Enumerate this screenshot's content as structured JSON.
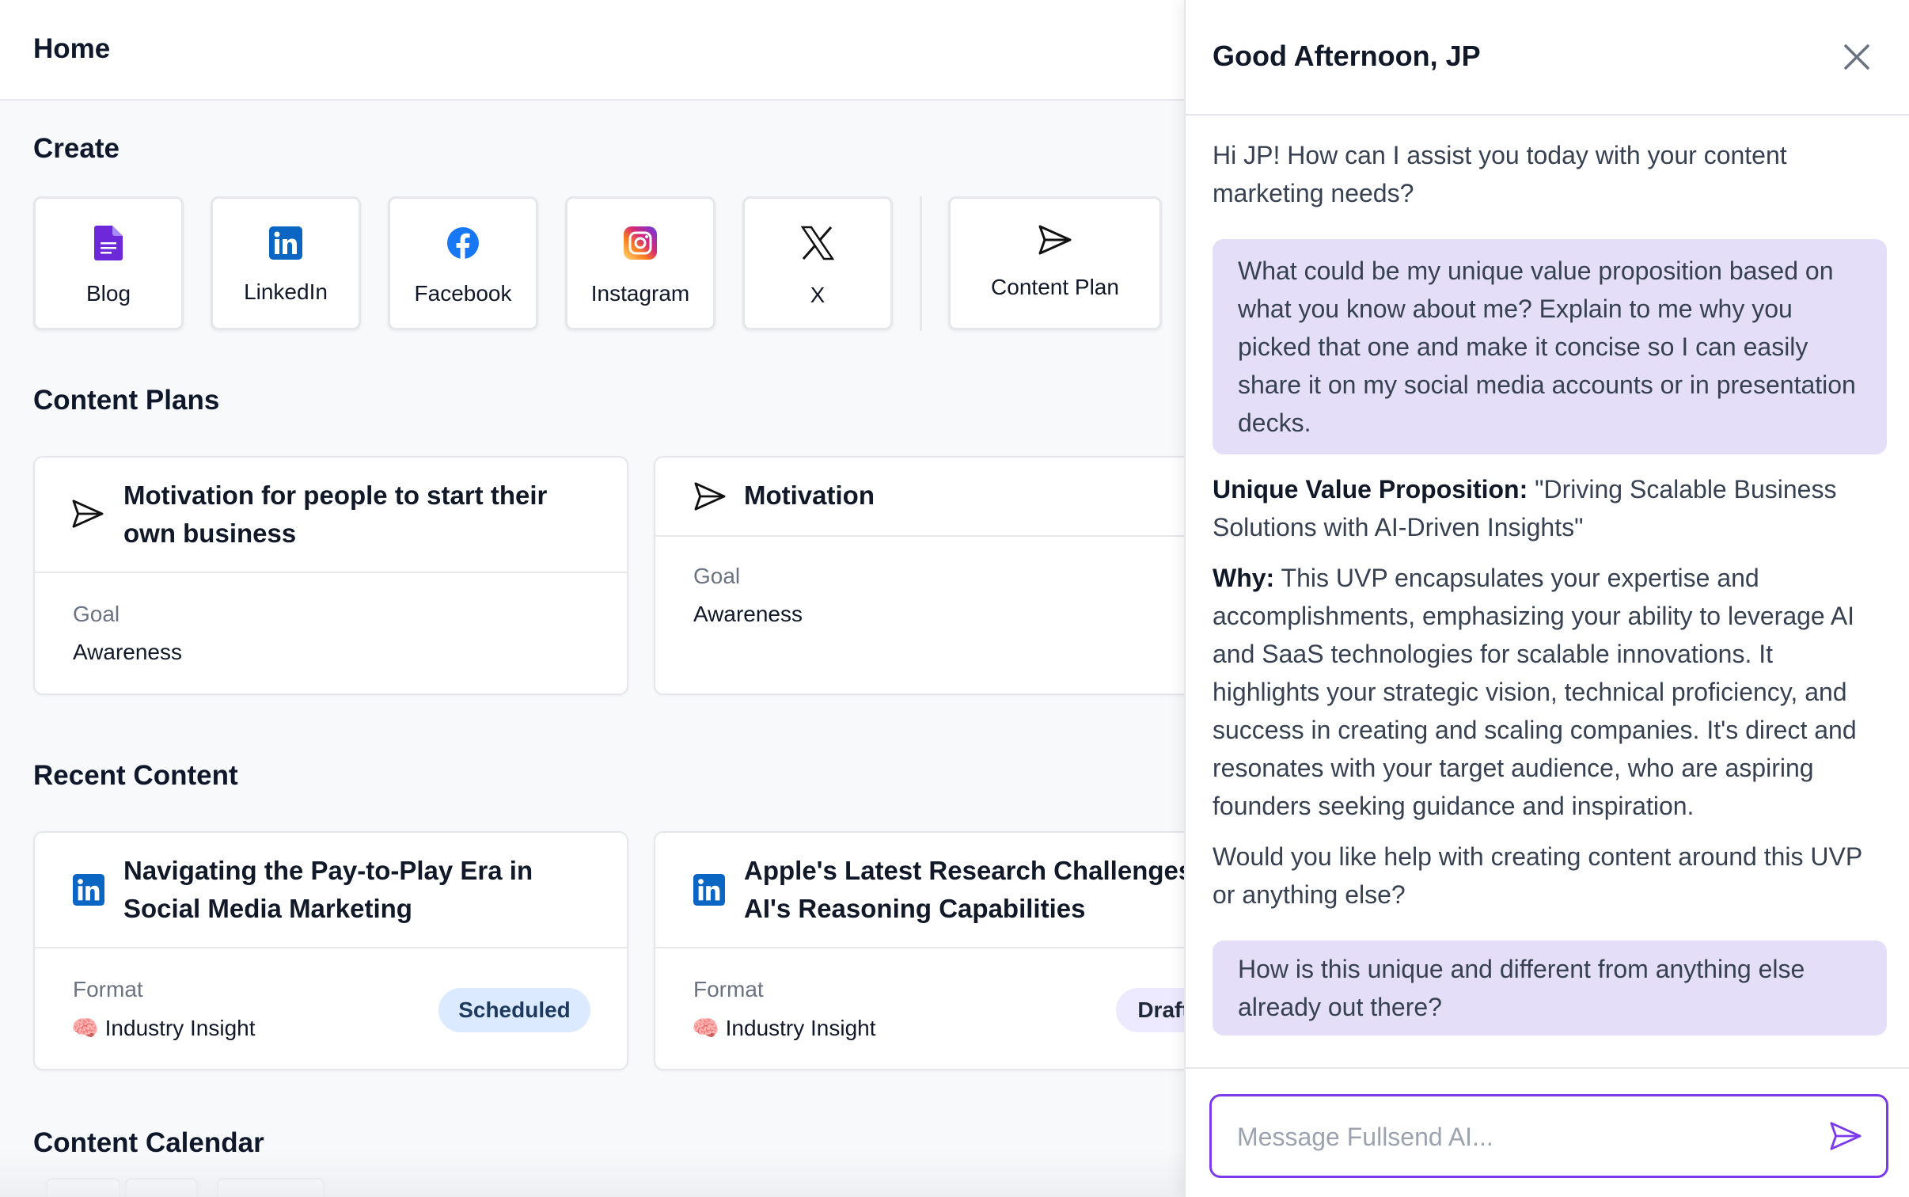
{
  "header": {
    "title": "Home"
  },
  "create": {
    "title": "Create",
    "tiles": [
      {
        "label": "Blog",
        "icon": "document-icon"
      },
      {
        "label": "LinkedIn",
        "icon": "linkedin-icon"
      },
      {
        "label": "Facebook",
        "icon": "facebook-icon"
      },
      {
        "label": "Instagram",
        "icon": "instagram-icon"
      },
      {
        "label": "X",
        "icon": "x-icon"
      },
      {
        "label": "Content Plan",
        "icon": "send-icon"
      }
    ]
  },
  "content_plans": {
    "title": "Content Plans",
    "items": [
      {
        "title": "Motivation for people to start their own business",
        "goal_label": "Goal",
        "goal": "Awareness"
      },
      {
        "title": "Motivation",
        "goal_label": "Goal",
        "goal": "Awareness"
      }
    ]
  },
  "recent_content": {
    "title": "Recent Content",
    "items": [
      {
        "title": "Navigating the Pay-to-Play Era in Social Media Marketing",
        "format_label": "Format",
        "format": "🧠 Industry Insight",
        "status": "Scheduled"
      },
      {
        "title": "Apple's Latest Research Challenges AI's Reasoning Capabilities",
        "format_label": "Format",
        "format": "🧠 Industry Insight",
        "status": "Draft"
      }
    ]
  },
  "calendar": {
    "title": "Content Calendar"
  },
  "chat": {
    "greeting": "Good Afternoon, JP",
    "messages": {
      "ai_intro": "Hi JP! How can I assist you today with your content marketing needs?",
      "user_1": "What could be my unique value proposition based on what you know about me? Explain to me why you picked that one and make it concise so I can easily share it on my social media accounts or in presentation decks.",
      "uvp_label": "Unique Value Proposition:",
      "uvp_text": " \"Driving Scalable Business Solutions with AI-Driven Insights\"",
      "why_label": "Why:",
      "why_text": " This UVP encapsulates your expertise and accomplishments, emphasizing your ability to leverage AI and SaaS technologies for scalable innovations. It highlights your strategic vision, technical proficiency, and success in creating and scaling companies. It's direct and resonates with your target audience, who are aspiring founders seeking guidance and inspiration.",
      "ai_followup": "Would you like help with creating content around this UVP or anything else?",
      "user_2": "How is this unique and different from anything else already out there?"
    },
    "input_placeholder": "Message Fullsend AI...",
    "input_value": ""
  },
  "colors": {
    "accent": "#7c3aed",
    "user_bubble": "#e4def9",
    "linkedin": "#0a66c2",
    "facebook": "#1877f2",
    "scheduled_badge": "#dbeafe",
    "draft_badge": "#ede9fe"
  }
}
